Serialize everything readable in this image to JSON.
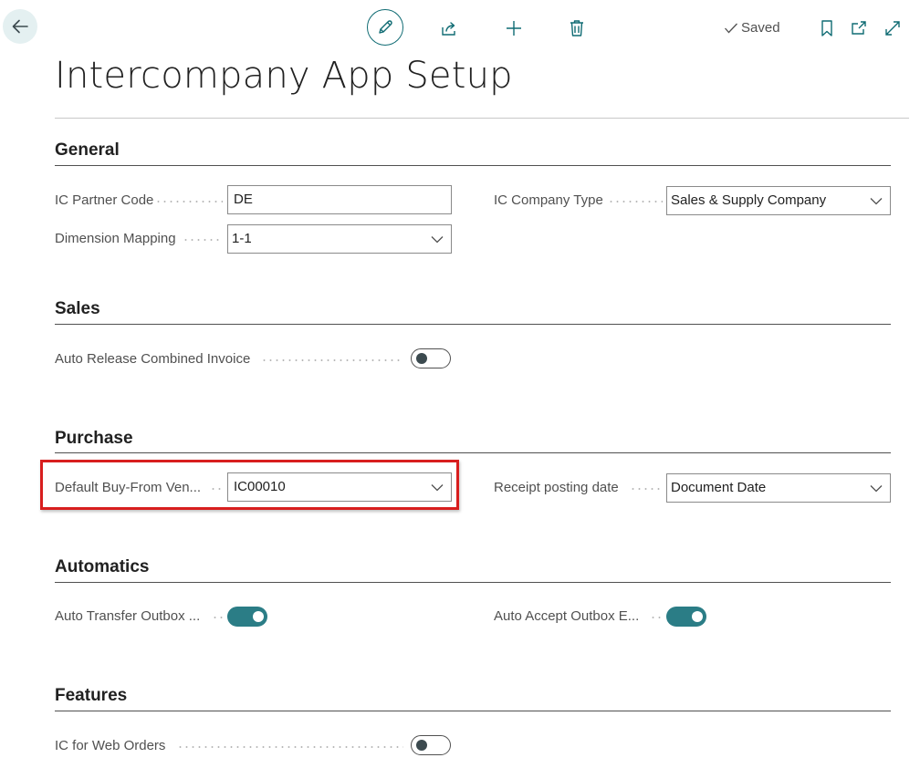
{
  "header": {
    "saved_label": "Saved",
    "icons": [
      "back-arrow-icon",
      "edit-pencil-icon",
      "share-icon",
      "plus-icon",
      "trash-icon",
      "checkmark-icon",
      "bookmark-icon",
      "open-in-new-window-icon",
      "expand-icon"
    ]
  },
  "page": {
    "title": "Intercompany App Setup"
  },
  "sections": {
    "general": {
      "title": "General",
      "ic_partner_code": {
        "label": "IC Partner Code",
        "value": "DE"
      },
      "ic_company_type": {
        "label": "IC Company Type",
        "value": "Sales & Supply Company"
      },
      "dimension_mapping": {
        "label": "Dimension Mapping",
        "value": "1-1"
      }
    },
    "sales": {
      "title": "Sales",
      "auto_release_combined_invoice": {
        "label": "Auto Release Combined Invoice",
        "enabled": false
      }
    },
    "purchase": {
      "title": "Purchase",
      "default_buy_from_vendor": {
        "label": "Default Buy-From Ven...",
        "value": "IC00010"
      },
      "receipt_posting_date": {
        "label": "Receipt posting date",
        "value": "Document Date"
      }
    },
    "automatics": {
      "title": "Automatics",
      "auto_transfer_outbox": {
        "label": "Auto Transfer Outbox ...",
        "enabled": true
      },
      "auto_accept_outbox": {
        "label": "Auto Accept Outbox E...",
        "enabled": true
      }
    },
    "features": {
      "title": "Features",
      "ic_for_web_orders": {
        "label": "IC for Web Orders",
        "enabled": false
      }
    }
  },
  "colors": {
    "accent": "#0f6b73",
    "toggle_on": "#2b7d86",
    "highlight_border": "#d81e1e",
    "back_button_bg": "#e4f0f1"
  }
}
